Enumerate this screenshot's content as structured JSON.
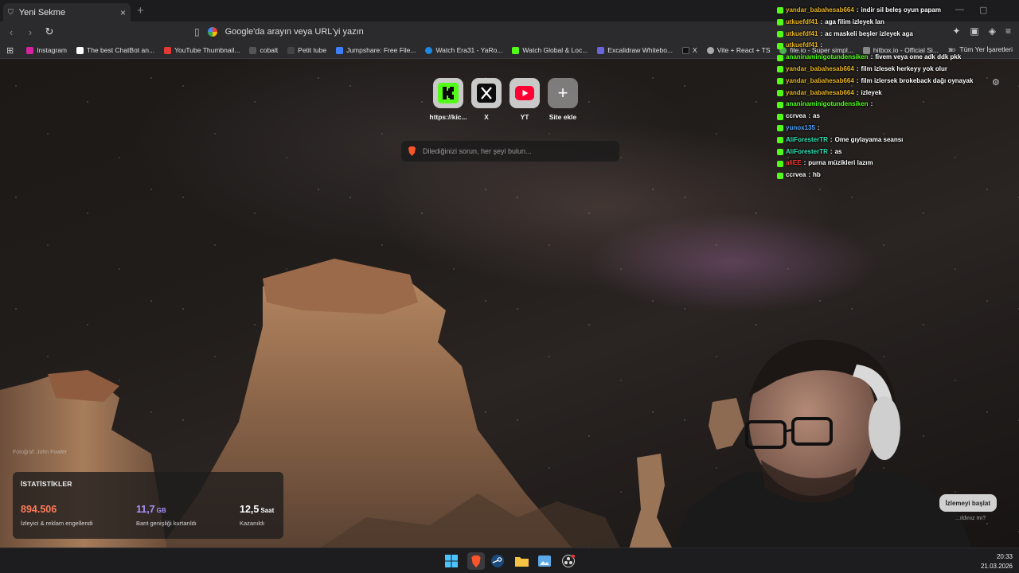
{
  "browser": {
    "tab_title": "Yeni Sekme",
    "tab_close": "×",
    "new_tab": "+",
    "omnibox_placeholder": "Google'da arayın veya URL'yi yazın"
  },
  "bookmarks": {
    "items": [
      {
        "label": "Instagram",
        "color": "#d6249f"
      },
      {
        "label": "The best ChatBot an...",
        "color": "#ffffff"
      },
      {
        "label": "YouTube Thumbnail...",
        "color": "#e53935"
      },
      {
        "label": "cobalt",
        "color": "#222222"
      },
      {
        "label": "Petit tube",
        "color": "#333333"
      },
      {
        "label": "Jumpshare: Free File...",
        "color": "#3d7fff"
      },
      {
        "label": "Watch Era31 - YaRo...",
        "color": "#1e88e5"
      },
      {
        "label": "Watch Global & Loc...",
        "color": "#53fc18"
      },
      {
        "label": "Excalidraw Whitebo...",
        "color": "#6965db"
      },
      {
        "label": "X",
        "color": "#000000"
      },
      {
        "label": "Vite + React + TS",
        "color": "#aaaaaa"
      },
      {
        "label": "file.io - Super simpl...",
        "color": "#4caf50"
      },
      {
        "label": "hitbox.io - Official Si...",
        "color": "#888888"
      }
    ],
    "more": "»",
    "all_bookmarks": "Tüm Yer İşaretleri"
  },
  "top_sites": [
    {
      "label": "https://kic...",
      "icon": "kick-icon"
    },
    {
      "label": "X",
      "icon": "x-icon"
    },
    {
      "label": "YT",
      "icon": "youtube-icon"
    },
    {
      "label": "Site ekle",
      "icon": "plus-icon"
    }
  ],
  "search": {
    "placeholder": "Dilediğinizi sorun, her şeyi bulun..."
  },
  "photo_credit": "Fotoğraf: John Fowler",
  "stats": {
    "title": "İSTATİSTİKLER",
    "items": [
      {
        "value": "894.506",
        "unit": "",
        "desc": "İzleyici & reklam engellendi",
        "color": "#ff7a59"
      },
      {
        "value": "11,7",
        "unit": "GB",
        "desc": "Bant genişliği kurtarıldı",
        "color": "#a892ff"
      },
      {
        "value": "12,5",
        "unit": "Saat",
        "desc": "Kazanıldı",
        "color": "#ffffff"
      }
    ]
  },
  "chat": [
    {
      "user": "yandar_babahesab664",
      "msg": "indir sil beleş oyun papam",
      "color": "#e6b422"
    },
    {
      "user": "utkuefdf41",
      "msg": "aga filim izleyek lan",
      "color": "#e6b422"
    },
    {
      "user": "utkuefdf41",
      "msg": "ac maskeli beşler izleyek aga",
      "color": "#e6b422"
    },
    {
      "user": "utkuefdf41",
      "msg": "",
      "color": "#e6b422"
    },
    {
      "user": "ananinaminigotundensiken",
      "msg": "fivem veya ome adk ddk pkk",
      "color": "#53fc18"
    },
    {
      "user": "yandar_babahesab664",
      "msg": "film izlesek herkeyy yok olur",
      "color": "#e6b422"
    },
    {
      "user": "yandar_babahesab664",
      "msg": "film izlersek brokeback dağı oynayak",
      "color": "#e6b422"
    },
    {
      "user": "yandar_babahesab664",
      "msg": "izleyek",
      "color": "#e6b422"
    },
    {
      "user": "ananinaminigotundensiken",
      "msg": "",
      "color": "#53fc18"
    },
    {
      "user": "ccrvea",
      "msg": "as",
      "color": "#ffffff"
    },
    {
      "user": "yunox135",
      "msg": "",
      "color": "#4fa3ff"
    },
    {
      "user": "AliForesterTR",
      "msg": "Ome gıylayama seansı",
      "color": "#2ee6b6"
    },
    {
      "user": "AliForesterTR",
      "msg": "as",
      "color": "#2ee6b6"
    },
    {
      "user": "aliEE",
      "msg": "purna müzikleri lazım",
      "color": "#ff3b3b"
    },
    {
      "user": "ccrvea",
      "msg": "hb",
      "color": "#ffffff"
    }
  ],
  "overlay_button": "İzlemeyi başlat",
  "overlay_link": "...ıldınız mı?",
  "clock": {
    "time": "20:33",
    "date": "21.03.2026"
  }
}
